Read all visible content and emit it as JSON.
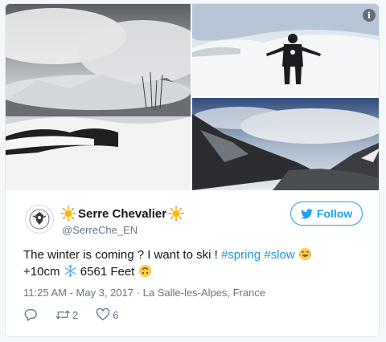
{
  "tweet": {
    "display_name": "Serre Chevalier",
    "handle": "@SerreChe_EN",
    "follow_label": "Follow",
    "text_line1_prefix": "The winter is coming ? I want to ski ! ",
    "hashtag1": "#spring",
    "hashtag2": "#slow",
    "text_line2_prefix": "+10cm",
    "text_line2_suffix": "6561 Feet",
    "timestamp": "11:25 AM - May 3, 2017",
    "separator": "·",
    "location": "La Salle-les-Alpes, France",
    "retweet_count": "2",
    "like_count": "6"
  },
  "icons": {
    "sun": "sun-emoji",
    "laugh": "tears-of-joy-emoji",
    "snowflake": "snowflake-emoji",
    "smile": "upside-down-smile-emoji",
    "info": "info-icon",
    "bird": "twitter-bird-icon",
    "reply": "reply-icon",
    "retweet": "retweet-icon",
    "like": "heart-icon"
  },
  "colors": {
    "accent": "#1da1f2",
    "hashtag": "#1b95e0",
    "muted": "#657786"
  }
}
